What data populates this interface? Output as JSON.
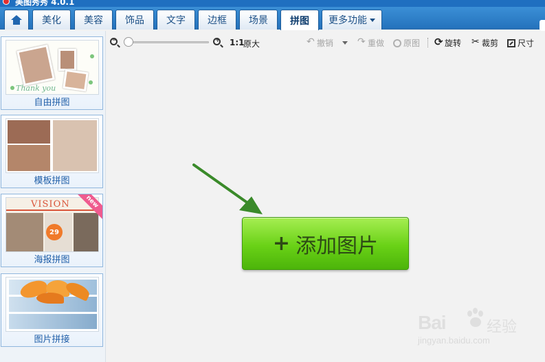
{
  "app": {
    "title": "美图秀秀 4.0.1"
  },
  "tabs": [
    {
      "label": "",
      "icon": "home-icon"
    },
    {
      "label": "美化"
    },
    {
      "label": "美容"
    },
    {
      "label": "饰品"
    },
    {
      "label": "文字"
    },
    {
      "label": "边框"
    },
    {
      "label": "场景"
    },
    {
      "label": "拼图",
      "active": true
    },
    {
      "label": "更多功能"
    }
  ],
  "sidebar": {
    "items": [
      {
        "label": "自由拼图",
        "thumb_text": "Thank you"
      },
      {
        "label": "模板拼图"
      },
      {
        "label": "海报拼图",
        "thumb_title": "VISION",
        "thumb_number": "29",
        "badge": "new"
      },
      {
        "label": "图片拼接"
      }
    ]
  },
  "toolbar": {
    "zoom_ratio": "1:1",
    "original_size": "原大",
    "zoom_level": 0.0,
    "undo": "撤销",
    "redo": "重做",
    "original": "原图",
    "rotate": "旋转",
    "crop": "裁剪",
    "size": "尺寸"
  },
  "canvas": {
    "add_button": "添加图片"
  },
  "watermark": {
    "brand_latin": "Bai",
    "brand_cn": "经验",
    "url": "jingyan.baidu.com"
  },
  "colors": {
    "tab_bar": "#2573bd",
    "label_blue": "#1f5ea8",
    "add_button": "#69d116",
    "arrow": "#3a8a2a"
  }
}
